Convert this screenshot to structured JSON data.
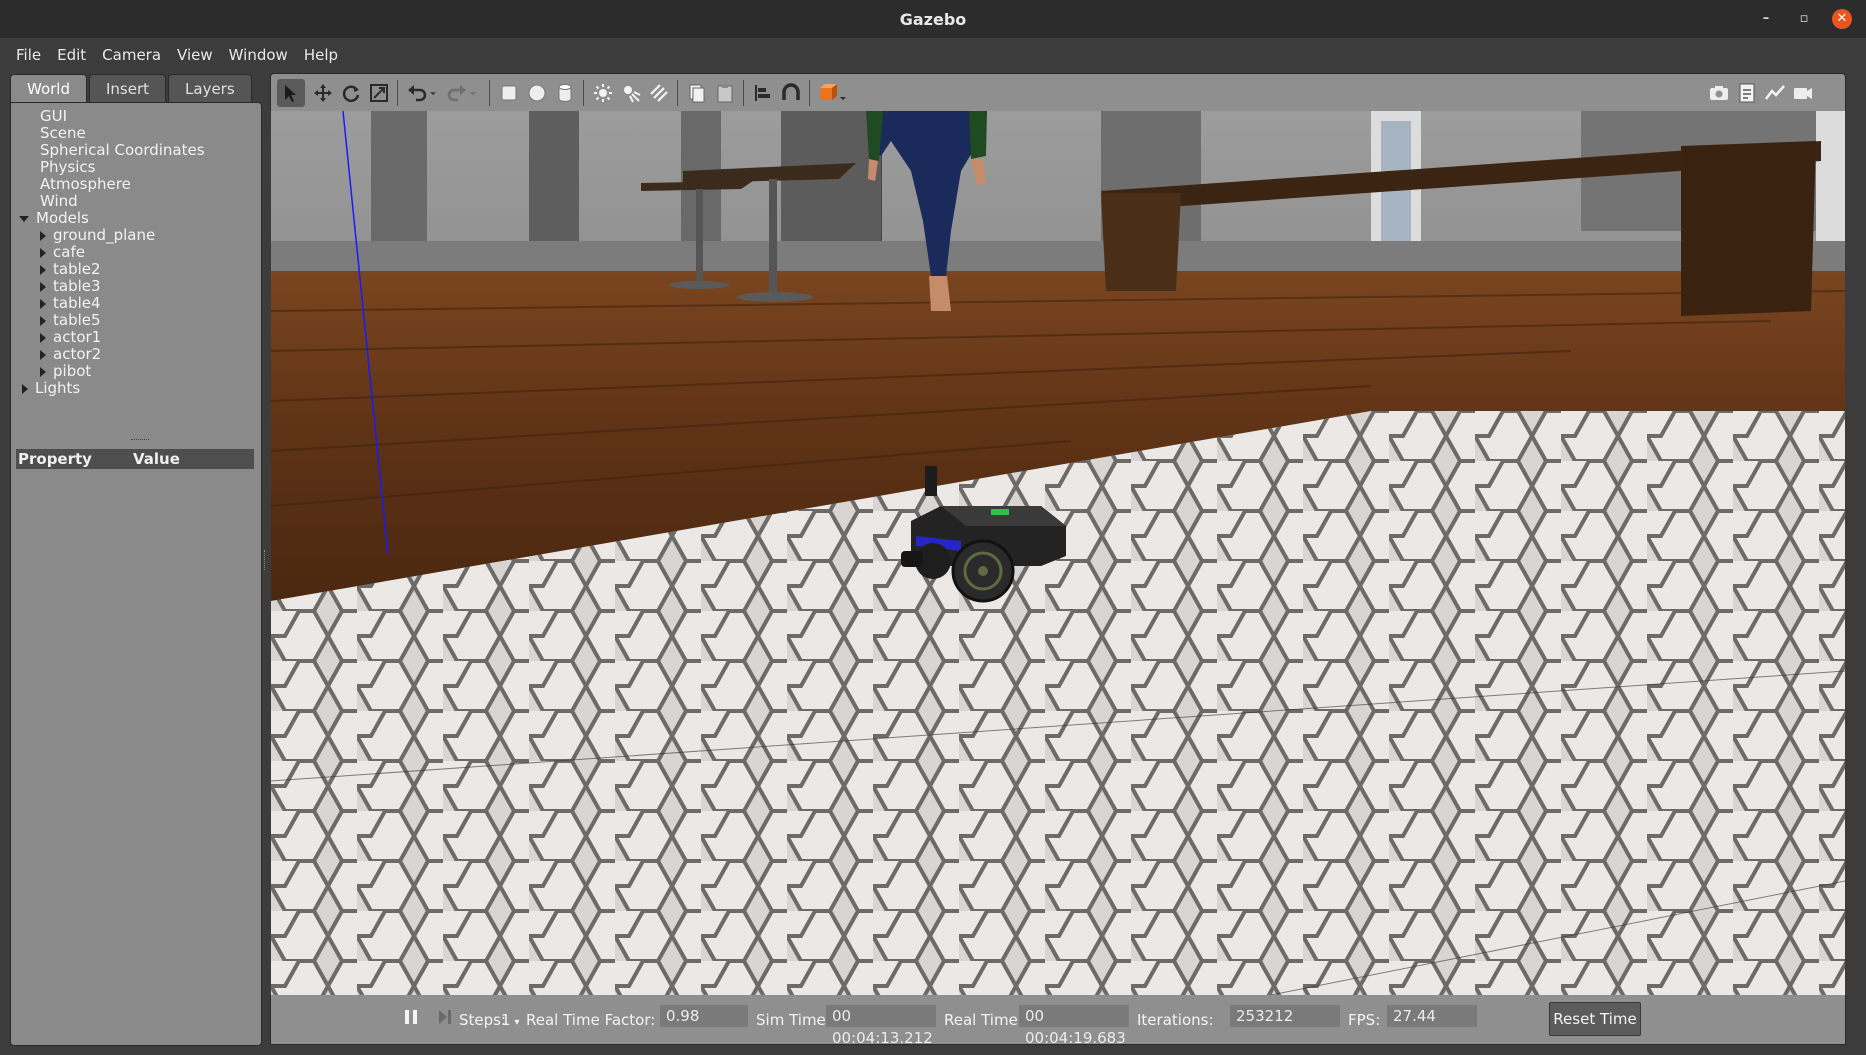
{
  "window": {
    "title": "Gazebo",
    "minimize_glyph": "–",
    "maximize_glyph": "▫",
    "close_glyph": "✕"
  },
  "menubar": [
    "File",
    "Edit",
    "Camera",
    "View",
    "Window",
    "Help"
  ],
  "left_panel": {
    "tabs": [
      {
        "label": "World",
        "active": true
      },
      {
        "label": "Insert",
        "active": false
      },
      {
        "label": "Layers",
        "active": false
      }
    ],
    "tree": {
      "top_items": [
        "GUI",
        "Scene",
        "Spherical Coordinates",
        "Physics",
        "Atmosphere",
        "Wind"
      ],
      "models_label": "Models",
      "models": [
        "ground_plane",
        "cafe",
        "table2",
        "table3",
        "table4",
        "table5",
        "actor1",
        "actor2",
        "pibot"
      ],
      "lights_label": "Lights"
    },
    "property_header": {
      "property": "Property",
      "value": "Value"
    }
  },
  "toolbar": {
    "tools": [
      "select-arrow-icon",
      "translate-icon",
      "rotate-icon",
      "scale-icon",
      "undo-icon",
      "undo-history-icon",
      "redo-icon",
      "redo-history-icon",
      "box-shape-icon",
      "sphere-shape-icon",
      "cylinder-shape-icon",
      "point-light-icon",
      "spot-light-icon",
      "directional-light-icon",
      "copy-icon",
      "paste-icon",
      "align-icon",
      "snap-icon",
      "view-angle-icon"
    ],
    "right_tools": [
      "screenshot-icon",
      "log-icon",
      "plot-icon",
      "record-video-icon"
    ]
  },
  "bottom_bar": {
    "steps_label": "Steps:",
    "steps_value": "1",
    "rtf_label": "Real Time Factor:",
    "rtf_value": "0.98",
    "sim_time_label": "Sim Time:",
    "sim_time_value": "00 00:04:13.212",
    "real_time_label": "Real Time:",
    "real_time_value": "00 00:04:19.683",
    "iterations_label": "Iterations:",
    "iterations_value": "253212",
    "fps_label": "FPS:",
    "fps_value": "27.44",
    "reset_label": "Reset Time"
  },
  "colors": {
    "accent_orange": "#e9541f",
    "panel_grey": "#8a8a8a",
    "floor_wood": "#6b3a1a",
    "tile_white": "#e8e4e2"
  }
}
